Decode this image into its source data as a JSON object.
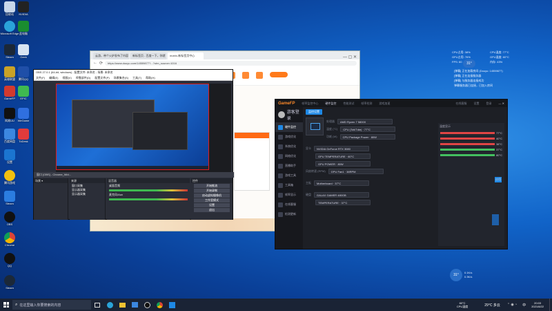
{
  "desktop": {
    "icons": [
      "回收站",
      "NVIDIA",
      "Microsoft Edge",
      "此电脑",
      "Steam",
      "Geek",
      "英雄联盟",
      "腾讯QQ",
      "GameFP",
      "EPIC",
      "网易UU",
      "WeGame",
      "百度网盘",
      "ToDesk",
      "设置",
      "腾讯游戏",
      "Steam",
      "OBS",
      "Chrome",
      "QQ",
      "Steam"
    ]
  },
  "browser": {
    "tabs": [
      "云游，带个火炉发布了内容",
      "新标签页 - 百度一下，你就",
      "motrix-新标签页中心"
    ],
    "url": "https://www.douyu.com/14559877?...?utm_source=1016"
  },
  "obs": {
    "title": "OBS 27.0.1 (64-bit, windows) - 配置文件: 未命名 - 场景: 未命名",
    "menu": [
      "文件(F)",
      "编辑(E)",
      "视图(V)",
      "停靠部件(D)",
      "配置文件(P)",
      "场景集合(S)",
      "工具(T)",
      "帮助(H)"
    ],
    "scenes_header": "场景 ▾",
    "sources_header": "来源",
    "sources": [
      "窗口采集",
      "显示器采集",
      "显示器采集"
    ],
    "mixer_header": "混音器",
    "mixer": [
      "桌面音频",
      "麦克风/Aux"
    ],
    "controls_header": "控件",
    "buttons": [
      "开始推流",
      "开始录制",
      "启动虚拟摄像机",
      "工作室模式",
      "设置",
      "退出"
    ],
    "toolbar_label": "窗口 [OBS] - Chrome_Wid..."
  },
  "gfp": {
    "brand": "GameFP",
    "brand_sub": "帧率监控中心",
    "top_tabs": [
      "硬件监控",
      "性能测试",
      "帧率检测",
      "游戏加速"
    ],
    "user": "游客登录",
    "side": [
      "硬件监控",
      "游戏优化",
      "系统优化",
      "网络优化",
      "直播助手",
      "游戏工具",
      "工具箱",
      "帧率显示",
      "在线客服",
      "检测更新"
    ],
    "section_title": "监控设置",
    "cpu_label": "处理器",
    "cpu_name": "AMD Ryzen 7 5800X",
    "cpu_temp": "CPU (Tctl/Tdie) · 77°C",
    "cpu_power": "CPU Package Power · 80W",
    "gpu_label": "显卡",
    "gpu_name": "NVIDIA GeForce RTX 3080",
    "gpu_temp": "GPU TEMPERATURE · 60°C",
    "gpu_power": "GPU POWER · 80W",
    "gpu_fan": "GPU Fan1 · 38RPM",
    "mb_label": "主板",
    "mb_temp": "Motherboard · 37°C",
    "disk_label": "硬盘",
    "disk_name": "GALAX GAMER 480GB",
    "disk_temp": "TEMPERATURE · 37°C",
    "temp_word": "温度 (°C)",
    "power_word": "功耗 (W)",
    "fan_word": "风扇转速 (RPM)",
    "right_title": "温度显示",
    "bars": [
      "77°C",
      "40°C",
      "38°C",
      "37°C",
      "80°C"
    ],
    "save": "应用",
    "right_btns": [
      "在线客服",
      "设置",
      "登录"
    ]
  },
  "overlay": {
    "lines": [
      "CPU占用: 38%",
      "GPU占用: 76%",
      "FPS: 60",
      "CPU温度: 77°C",
      "GPU温度: 60°C",
      "内存: 43%"
    ],
    "chat": [
      "[弹幕] 正在加载房间 (Douyu: 14559877)",
      "[弹幕] 正在连接服务器",
      "[弹幕] 与服务器连接成功",
      "弹幕服务器已连接，已加入房间"
    ],
    "temp_badge": "31°",
    "speed1": "0.1K/s",
    "speed2": "0.3K/s",
    "cpu_stat": "68°C CPU温度"
  },
  "taskbar": {
    "search_placeholder": "在这里输入你要搜索的内容",
    "weather": "29°C 多云",
    "ime": "中",
    "time": "20:03",
    "date": "2021/8/22",
    "cpu_tray": "60°C\nCPU温度"
  },
  "colors": {
    "obs_red_border": "#e21d1d",
    "gfp_accent": "#1e88e5",
    "bar_red": "#e04545",
    "bar_green": "#44c060"
  }
}
